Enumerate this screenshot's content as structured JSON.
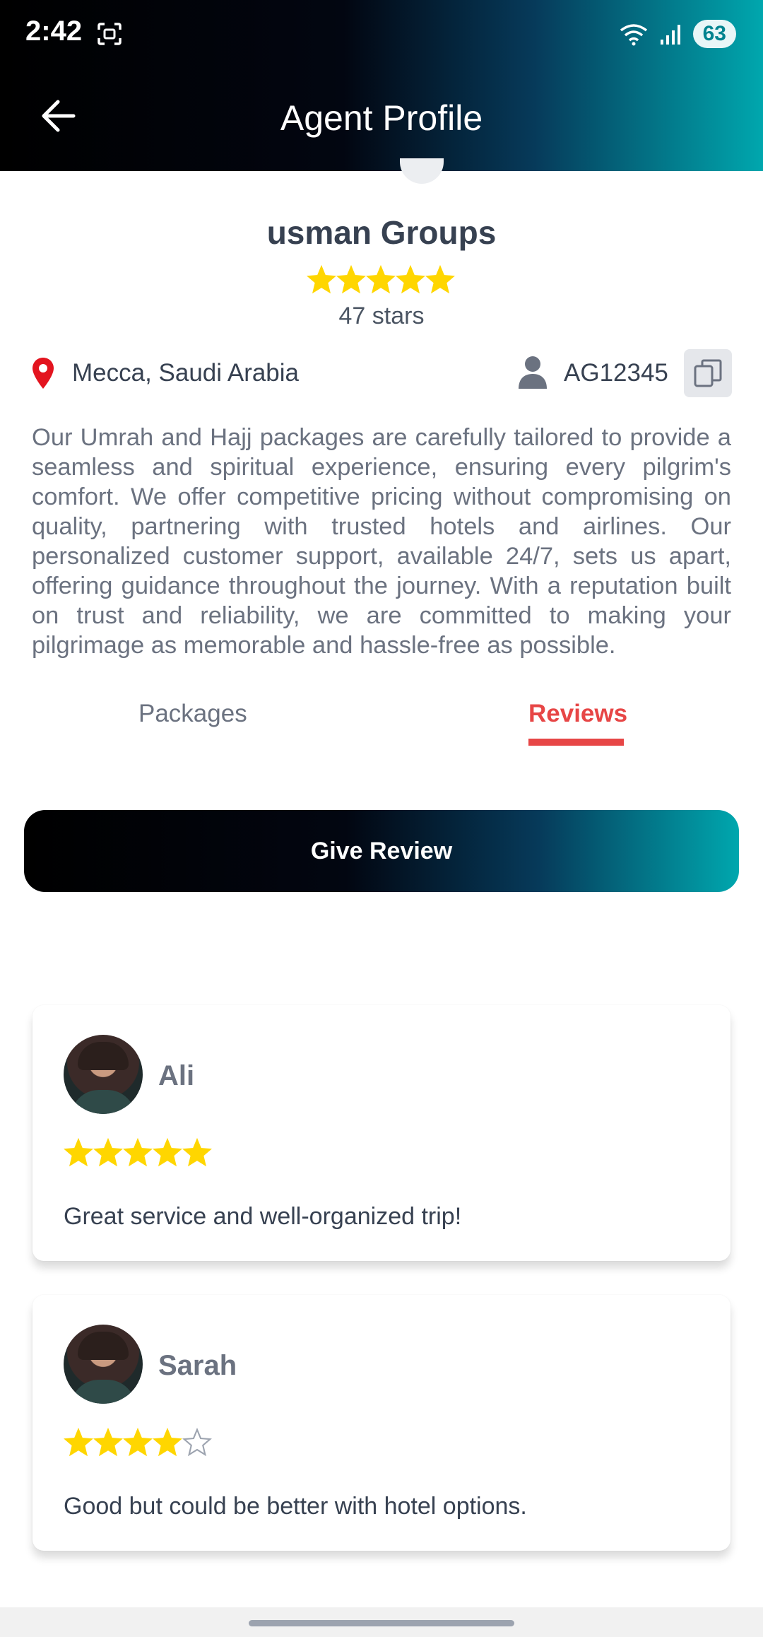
{
  "status_bar": {
    "time": "2:42",
    "battery": "63"
  },
  "header": {
    "title": "Agent Profile"
  },
  "agent": {
    "name": "usman Groups",
    "rating": 5,
    "stars_label": "47 stars",
    "location": "Mecca, Saudi Arabia",
    "agent_id": "AG12345",
    "description": "Our Umrah and Hajj packages are carefully tailored to provide a seamless and spiritual experience, ensuring every pilgrim's comfort. We offer competitive pricing without compromising on quality, partnering with trusted hotels and airlines. Our personalized customer support, available 24/7, sets us apart, offering guidance throughout the journey. With a reputation built on trust and reliability, we are committed to making your pilgrimage as memorable and hassle-free as possible."
  },
  "tabs": [
    {
      "label": "Packages",
      "active": false
    },
    {
      "label": "Reviews",
      "active": true
    }
  ],
  "give_review_label": "Give Review",
  "reviews": [
    {
      "name": "Ali",
      "rating": 5,
      "text": "Great service and well-organized trip!"
    },
    {
      "name": "Sarah",
      "rating": 4,
      "text": "Good but could be better with hotel options."
    }
  ],
  "colors": {
    "accent": "#e74646",
    "star": "#ffd600",
    "gradient_end": "#00a7ae"
  }
}
